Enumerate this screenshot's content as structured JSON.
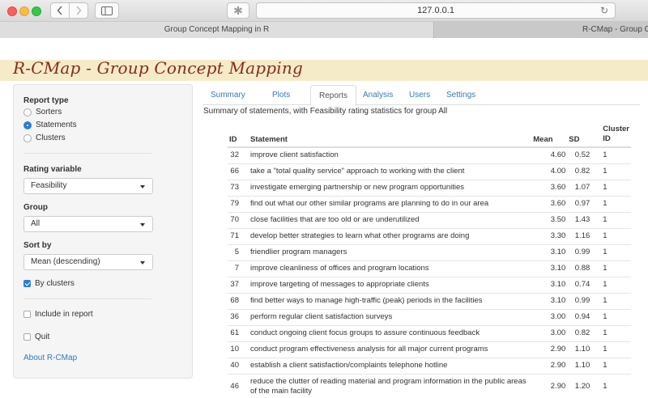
{
  "browser": {
    "url": "127.0.0.1",
    "tabs": [
      {
        "label": "Group Concept Mapping in R",
        "active": true
      },
      {
        "label": "R-CMap - Group Concept Mappin",
        "active": false
      }
    ]
  },
  "app": {
    "title": "R-CMap - Group Concept Mapping",
    "title_color": "#8a2a1a",
    "header_bg": "#f5ebc8"
  },
  "sidebar": {
    "report_type": {
      "label": "Report type",
      "options": [
        "Sorters",
        "Statements",
        "Clusters"
      ],
      "selected": "Statements"
    },
    "rating_variable": {
      "label": "Rating variable",
      "value": "Feasibility"
    },
    "group": {
      "label": "Group",
      "value": "All"
    },
    "sort_by": {
      "label": "Sort by",
      "value": "Mean (descending)"
    },
    "by_clusters": {
      "label": "By clusters",
      "checked": true
    },
    "include_in_report": {
      "label": "Include in report",
      "checked": false
    },
    "quit": {
      "label": "Quit",
      "checked": false
    },
    "about_link": "About R-CMap"
  },
  "main": {
    "tabs": [
      "Summary",
      "Plots",
      "Reports",
      "Analysis",
      "Users",
      "Settings"
    ],
    "active_tab": "Reports",
    "summary_text": "Summary of statements, with Feasibility rating statistics for group All",
    "table": {
      "headers": {
        "id": "ID",
        "statement": "Statement",
        "mean": "Mean",
        "sd": "SD",
        "cluster": "Cluster ID"
      },
      "rows": [
        {
          "id": "32",
          "statement": "improve client satisfaction",
          "mean": "4.60",
          "sd": "0.52",
          "cluster": "1"
        },
        {
          "id": "66",
          "statement": "take a \"total quality service\" approach to working with the client",
          "mean": "4.00",
          "sd": "0.82",
          "cluster": "1"
        },
        {
          "id": "73",
          "statement": "investigate emerging partnership or new program opportunities",
          "mean": "3.60",
          "sd": "1.07",
          "cluster": "1"
        },
        {
          "id": "79",
          "statement": "find out what our other similar programs are planning to do in our area",
          "mean": "3.60",
          "sd": "0.97",
          "cluster": "1"
        },
        {
          "id": "70",
          "statement": "close facilities that are too old or are underutilized",
          "mean": "3.50",
          "sd": "1.43",
          "cluster": "1"
        },
        {
          "id": "71",
          "statement": "develop better strategies to learn what other programs are doing",
          "mean": "3.30",
          "sd": "1.16",
          "cluster": "1"
        },
        {
          "id": "5",
          "statement": "friendlier program managers",
          "mean": "3.10",
          "sd": "0.99",
          "cluster": "1"
        },
        {
          "id": "7",
          "statement": "improve cleanliness of offices and program locations",
          "mean": "3.10",
          "sd": "0.88",
          "cluster": "1"
        },
        {
          "id": "37",
          "statement": "improve targeting of messages to appropriate clients",
          "mean": "3.10",
          "sd": "0.74",
          "cluster": "1"
        },
        {
          "id": "68",
          "statement": "find better ways to manage high-traffic (peak) periods in the facilities",
          "mean": "3.10",
          "sd": "0.99",
          "cluster": "1"
        },
        {
          "id": "36",
          "statement": "perform regular client satisfaction surveys",
          "mean": "3.00",
          "sd": "0.94",
          "cluster": "1"
        },
        {
          "id": "61",
          "statement": "conduct ongoing client focus groups to assure continuous feedback",
          "mean": "3.00",
          "sd": "0.82",
          "cluster": "1"
        },
        {
          "id": "10",
          "statement": "conduct program effectiveness analysis for all major current programs",
          "mean": "2.90",
          "sd": "1.10",
          "cluster": "1"
        },
        {
          "id": "40",
          "statement": "establish a client satisfaction/complaints telephone hotline",
          "mean": "2.90",
          "sd": "1.10",
          "cluster": "1"
        },
        {
          "id": "46",
          "statement": "reduce the clutter of reading material and program information in the public areas of the main facility",
          "mean": "2.90",
          "sd": "1.20",
          "cluster": "1"
        }
      ]
    }
  }
}
